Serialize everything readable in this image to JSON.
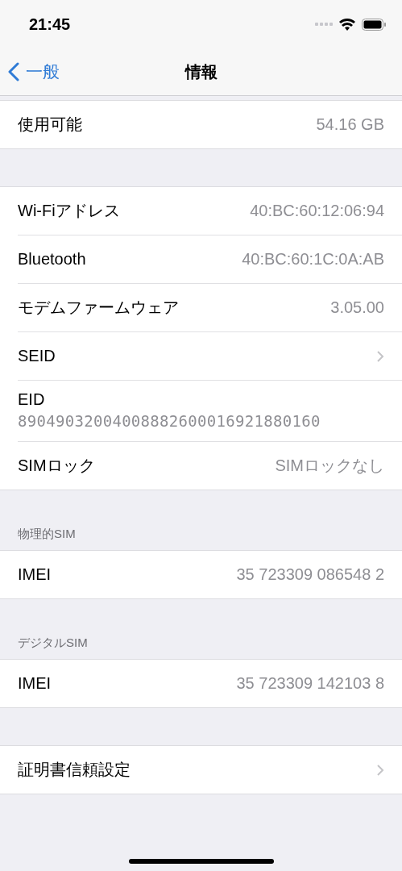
{
  "status_bar": {
    "time": "21:45"
  },
  "nav": {
    "back": "一般",
    "title": "情報"
  },
  "sections": [
    {
      "rows": [
        {
          "kind": "value",
          "label": "使用可能",
          "value": "54.16 GB"
        }
      ]
    },
    {
      "rows": [
        {
          "kind": "value",
          "label": "Wi-Fiアドレス",
          "value": "40:BC:60:12:06:94"
        },
        {
          "kind": "value",
          "label": "Bluetooth",
          "value": "40:BC:60:1C:0A:AB"
        },
        {
          "kind": "value",
          "label": "モデムファームウェア",
          "value": "3.05.00"
        },
        {
          "kind": "disclosure",
          "label": "SEID"
        },
        {
          "kind": "stacked",
          "label": "EID",
          "value": "89049032004008882600016921880160"
        },
        {
          "kind": "value",
          "label": "SIMロック",
          "value": "SIMロックなし"
        }
      ]
    },
    {
      "header": "物理的SIM",
      "rows": [
        {
          "kind": "value",
          "label": "IMEI",
          "value": "35 723309 086548 2"
        }
      ]
    },
    {
      "header": "デジタルSIM",
      "rows": [
        {
          "kind": "value",
          "label": "IMEI",
          "value": "35 723309 142103 8"
        }
      ]
    },
    {
      "rows": [
        {
          "kind": "disclosure",
          "label": "証明書信頼設定"
        }
      ]
    }
  ]
}
